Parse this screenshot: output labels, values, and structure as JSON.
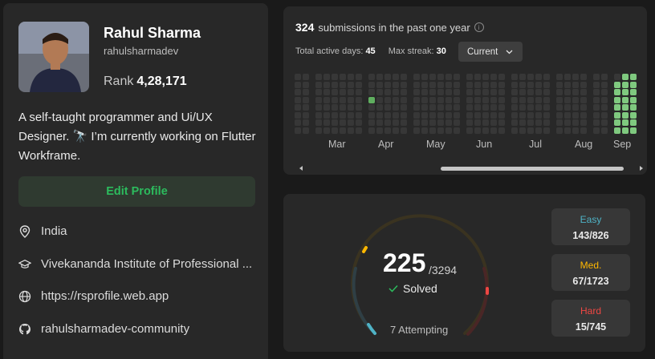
{
  "profile": {
    "name": "Rahul Sharma",
    "handle": "rahulsharmadev",
    "rank_label": "Rank",
    "rank_value": "4,28,171",
    "bio": "A self-taught programmer and Ui/UX Designer. 🔭 I’m currently working on Flutter Workframe.",
    "edit_label": "Edit Profile",
    "info": [
      {
        "icon": "location-pin-icon",
        "text": "India"
      },
      {
        "icon": "graduation-cap-icon",
        "text": "Vivekananda Institute of Professional ..."
      },
      {
        "icon": "globe-icon",
        "text": "https://rsprofile.web.app"
      },
      {
        "icon": "github-icon",
        "text": "rahulsharmadev-community"
      }
    ]
  },
  "heatmap": {
    "count": "324",
    "title": "submissions in the past one year",
    "active_label": "Total active days:",
    "active_value": "45",
    "streak_label": "Max streak:",
    "streak_value": "30",
    "dropdown": "Current",
    "months": [
      "Mar",
      "Apr",
      "May",
      "Jun",
      "Jul",
      "Aug",
      "Sep"
    ]
  },
  "progress": {
    "solved": "225",
    "total": "/3294",
    "solved_label": "Solved",
    "attempting": "7 Attempting",
    "difficulty": [
      {
        "label": "Easy",
        "value": "143/826",
        "color": "#4fb3c6"
      },
      {
        "label": "Med.",
        "value": "67/1723",
        "color": "#ffb800"
      },
      {
        "label": "Hard",
        "value": "15/745",
        "color": "#ef4743"
      }
    ]
  },
  "colors": {
    "accent_green": "#2cbb5d",
    "cell_empty": "#373737",
    "cell_light": "#7fc97f",
    "cell_mid": "#5fae5f",
    "cell_dark": "#2f6e3b"
  }
}
